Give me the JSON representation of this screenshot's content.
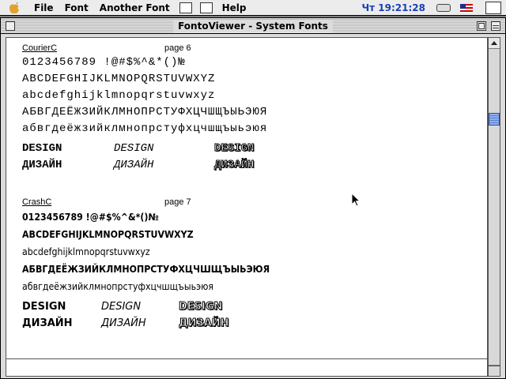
{
  "menubar": {
    "menus": [
      "File",
      "Font",
      "Another Font",
      "Help"
    ],
    "clock": "Чт 19:21:28"
  },
  "window": {
    "title": "FontoViewer - System Fonts"
  },
  "specimens": [
    {
      "font_name": "CourierC",
      "page_label": "page 6",
      "lines": [
        "0123456789 !@#$%^&*()№",
        "ABCDEFGHIJKLMNOPQRSTUVWXYZ",
        "abcdefghijklmnopqrstuvwxyz",
        "АБВГДЕЁЖЗИЙКЛМНОПРСТУФХЦЧШЩЪЫЬЭЮЯ",
        "абвгдеёжзийклмнопрстуфхцчшщъыьэюя"
      ],
      "design_latin": [
        "DESIGN",
        "DESIGN",
        "DESIGN"
      ],
      "design_cyr": [
        "ДИЗАЙН",
        "ДИЗАЙН",
        "ДИЗАЙН"
      ]
    },
    {
      "font_name": "CrashC",
      "page_label": "page 7",
      "lines": [
        "0123456789 !@#$%^&*()№",
        "ABCDEFGHIJKLMNOPQRSTUVWXYZ",
        "abcdefghijklmnopqrstuvwxyz",
        "АБВГДЕЁЖЗИЙКЛМНОПРСТУФХЦЧШЩЪЫЬЭЮЯ",
        "абвгдеёжзийклмнопрстуфхцчшщъыьэюя"
      ],
      "design_latin": [
        "DESIGN",
        "DESIGN",
        "DESIGN"
      ],
      "design_cyr": [
        "ДИЗАЙН",
        "ДИЗАЙН",
        "ДИЗАЙН"
      ]
    }
  ]
}
